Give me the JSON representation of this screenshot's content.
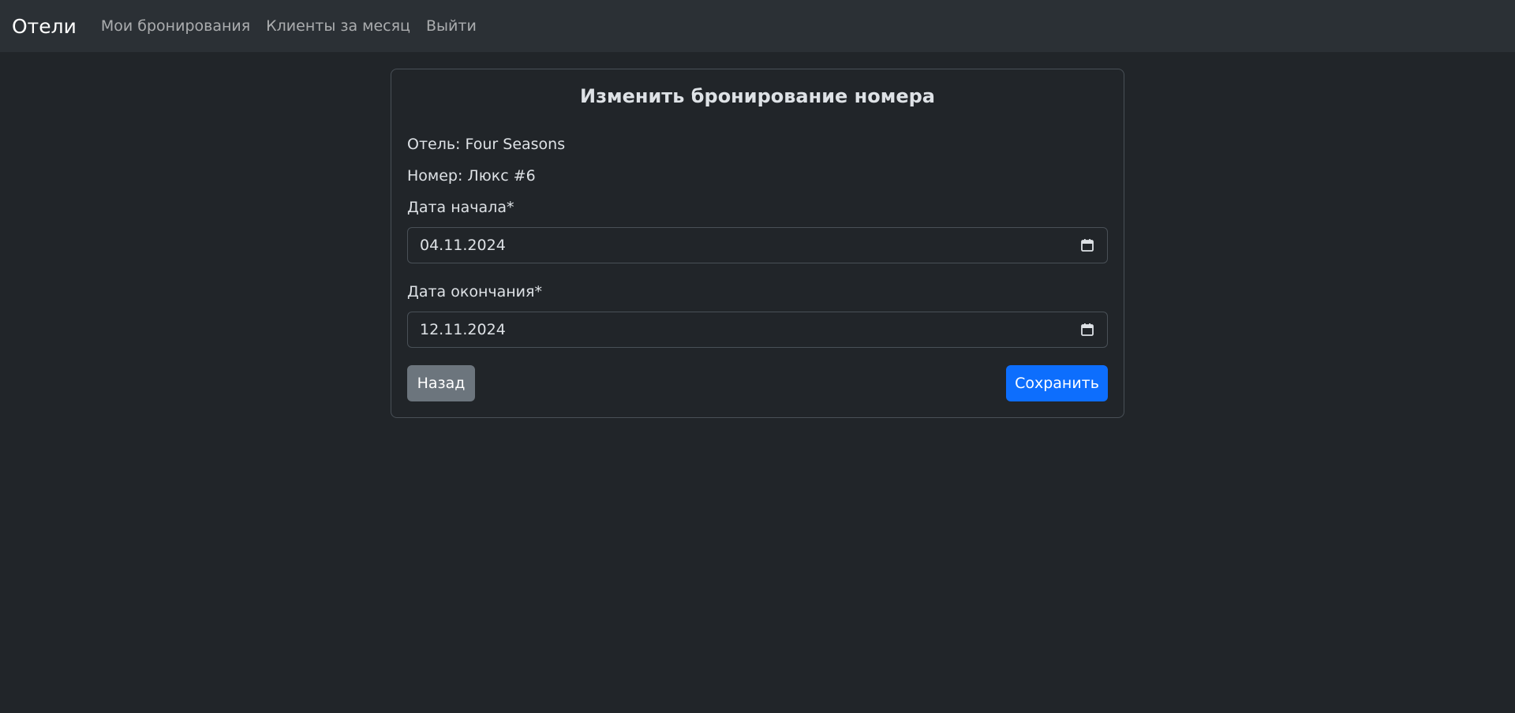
{
  "navbar": {
    "brand": "Отели",
    "links": [
      "Мои бронирования",
      "Клиенты за месяц",
      "Выйти"
    ]
  },
  "form": {
    "title": "Изменить бронирование номера",
    "hotel": "Отель: Four Seasons",
    "room": "Номер: Люкс #6",
    "start_label": "Дата начала*",
    "start_value": "04.11.2024",
    "end_label": "Дата окончания*",
    "end_value": "12.11.2024",
    "back_label": "Назад",
    "save_label": "Сохранить"
  },
  "icons": {
    "date_picker": "calendar-icon"
  },
  "colors": {
    "background": "#212529",
    "navbar": "#2b3035",
    "primary": "#0d6efd",
    "secondary": "#6c757d"
  }
}
